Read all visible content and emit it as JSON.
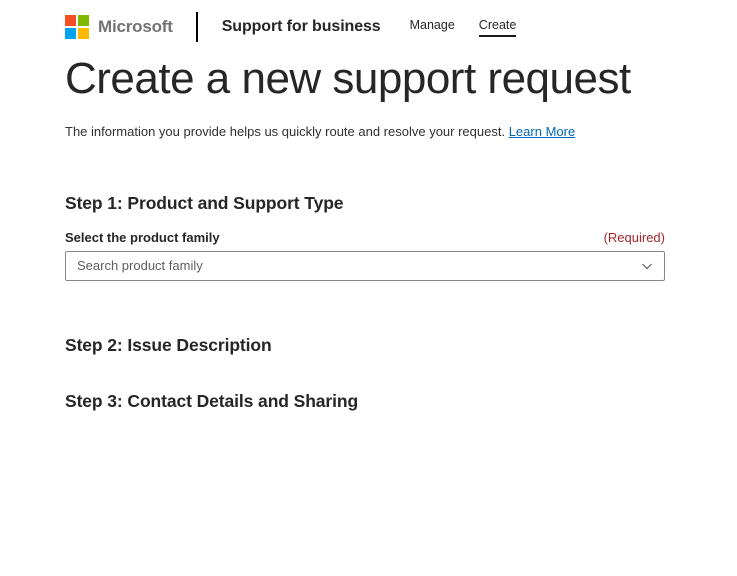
{
  "header": {
    "brand": "Microsoft",
    "app_title": "Support for business",
    "nav": [
      {
        "label": "Manage",
        "active": false
      },
      {
        "label": "Create",
        "active": true
      }
    ]
  },
  "page": {
    "title": "Create a new support request",
    "intro": "The information you provide helps us quickly route and resolve your request.",
    "learn_more": "Learn More"
  },
  "form": {
    "step1": {
      "heading": "Step 1: Product and Support Type",
      "product_family": {
        "label": "Select the product family",
        "required": "(Required)",
        "placeholder": "Search product family",
        "value": ""
      }
    },
    "step2": {
      "heading": "Step 2: Issue Description"
    },
    "step3": {
      "heading": "Step 3: Contact Details and Sharing"
    }
  },
  "icons": {
    "dropdown": "chevron-down-icon"
  },
  "colors": {
    "logo_red": "#F25022",
    "logo_green": "#7FBA00",
    "logo_blue": "#00A4EF",
    "logo_yellow": "#FFB900",
    "brand_gray": "#737373",
    "text_dark": "#262626",
    "link_blue": "#0067B8",
    "required_red": "#A4262C",
    "input_border": "#8A8886",
    "placeholder_gray": "#605E5C"
  }
}
